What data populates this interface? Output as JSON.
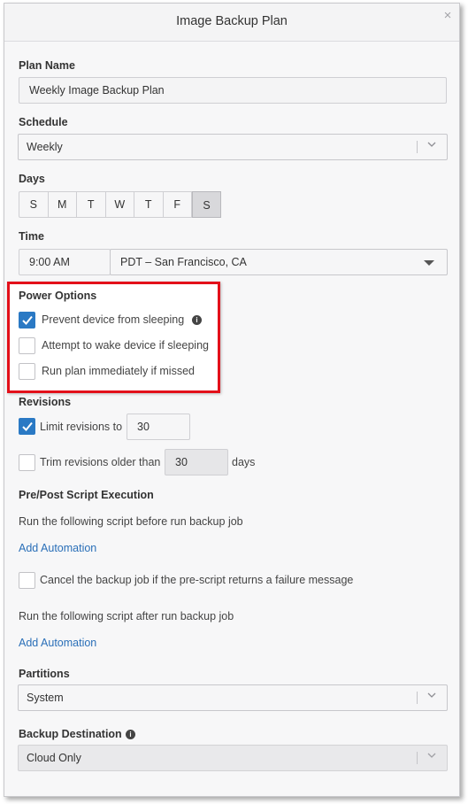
{
  "dialog": {
    "title": "Image Backup Plan",
    "close_glyph": "×"
  },
  "plan_name": {
    "label": "Plan Name",
    "value": "Weekly Image Backup Plan"
  },
  "schedule": {
    "label": "Schedule",
    "value": "Weekly"
  },
  "days": {
    "label": "Days",
    "items": [
      {
        "label": "S",
        "selected": false
      },
      {
        "label": "M",
        "selected": false
      },
      {
        "label": "T",
        "selected": false
      },
      {
        "label": "W",
        "selected": false
      },
      {
        "label": "T",
        "selected": false
      },
      {
        "label": "F",
        "selected": false
      },
      {
        "label": "S",
        "selected": true
      }
    ]
  },
  "time": {
    "label": "Time",
    "value": "9:00 AM",
    "timezone": "PDT – San Francisco, CA"
  },
  "power_options": {
    "label": "Power Options",
    "prevent_sleep": {
      "label": "Prevent device from sleeping",
      "checked": true
    },
    "wake_device": {
      "label": "Attempt to wake device if sleeping",
      "checked": false
    },
    "run_missed": {
      "label": "Run plan immediately if missed",
      "checked": false
    }
  },
  "revisions": {
    "label": "Revisions",
    "limit": {
      "label": "Limit revisions to",
      "checked": true,
      "value": "30"
    },
    "trim": {
      "label": "Trim revisions older than",
      "checked": false,
      "value": "30",
      "unit": "days"
    }
  },
  "scripts": {
    "label": "Pre/Post Script Execution",
    "pre_text": "Run the following script before run backup job",
    "pre_link": "Add Automation",
    "cancel": {
      "label": "Cancel the backup job if the pre-script returns a failure message",
      "checked": false
    },
    "post_text": "Run the following script after run backup job",
    "post_link": "Add Automation"
  },
  "partitions": {
    "label": "Partitions",
    "value": "System"
  },
  "destination": {
    "label": "Backup Destination",
    "value": "Cloud Only"
  },
  "icons": {
    "info": "info-icon",
    "check": "checkmark-icon",
    "chevron": "chevron-down-icon",
    "caret": "caret-down-icon"
  },
  "colors": {
    "accent": "#2a79c4",
    "link": "#2a6fb8",
    "highlight": "#e3101a"
  }
}
